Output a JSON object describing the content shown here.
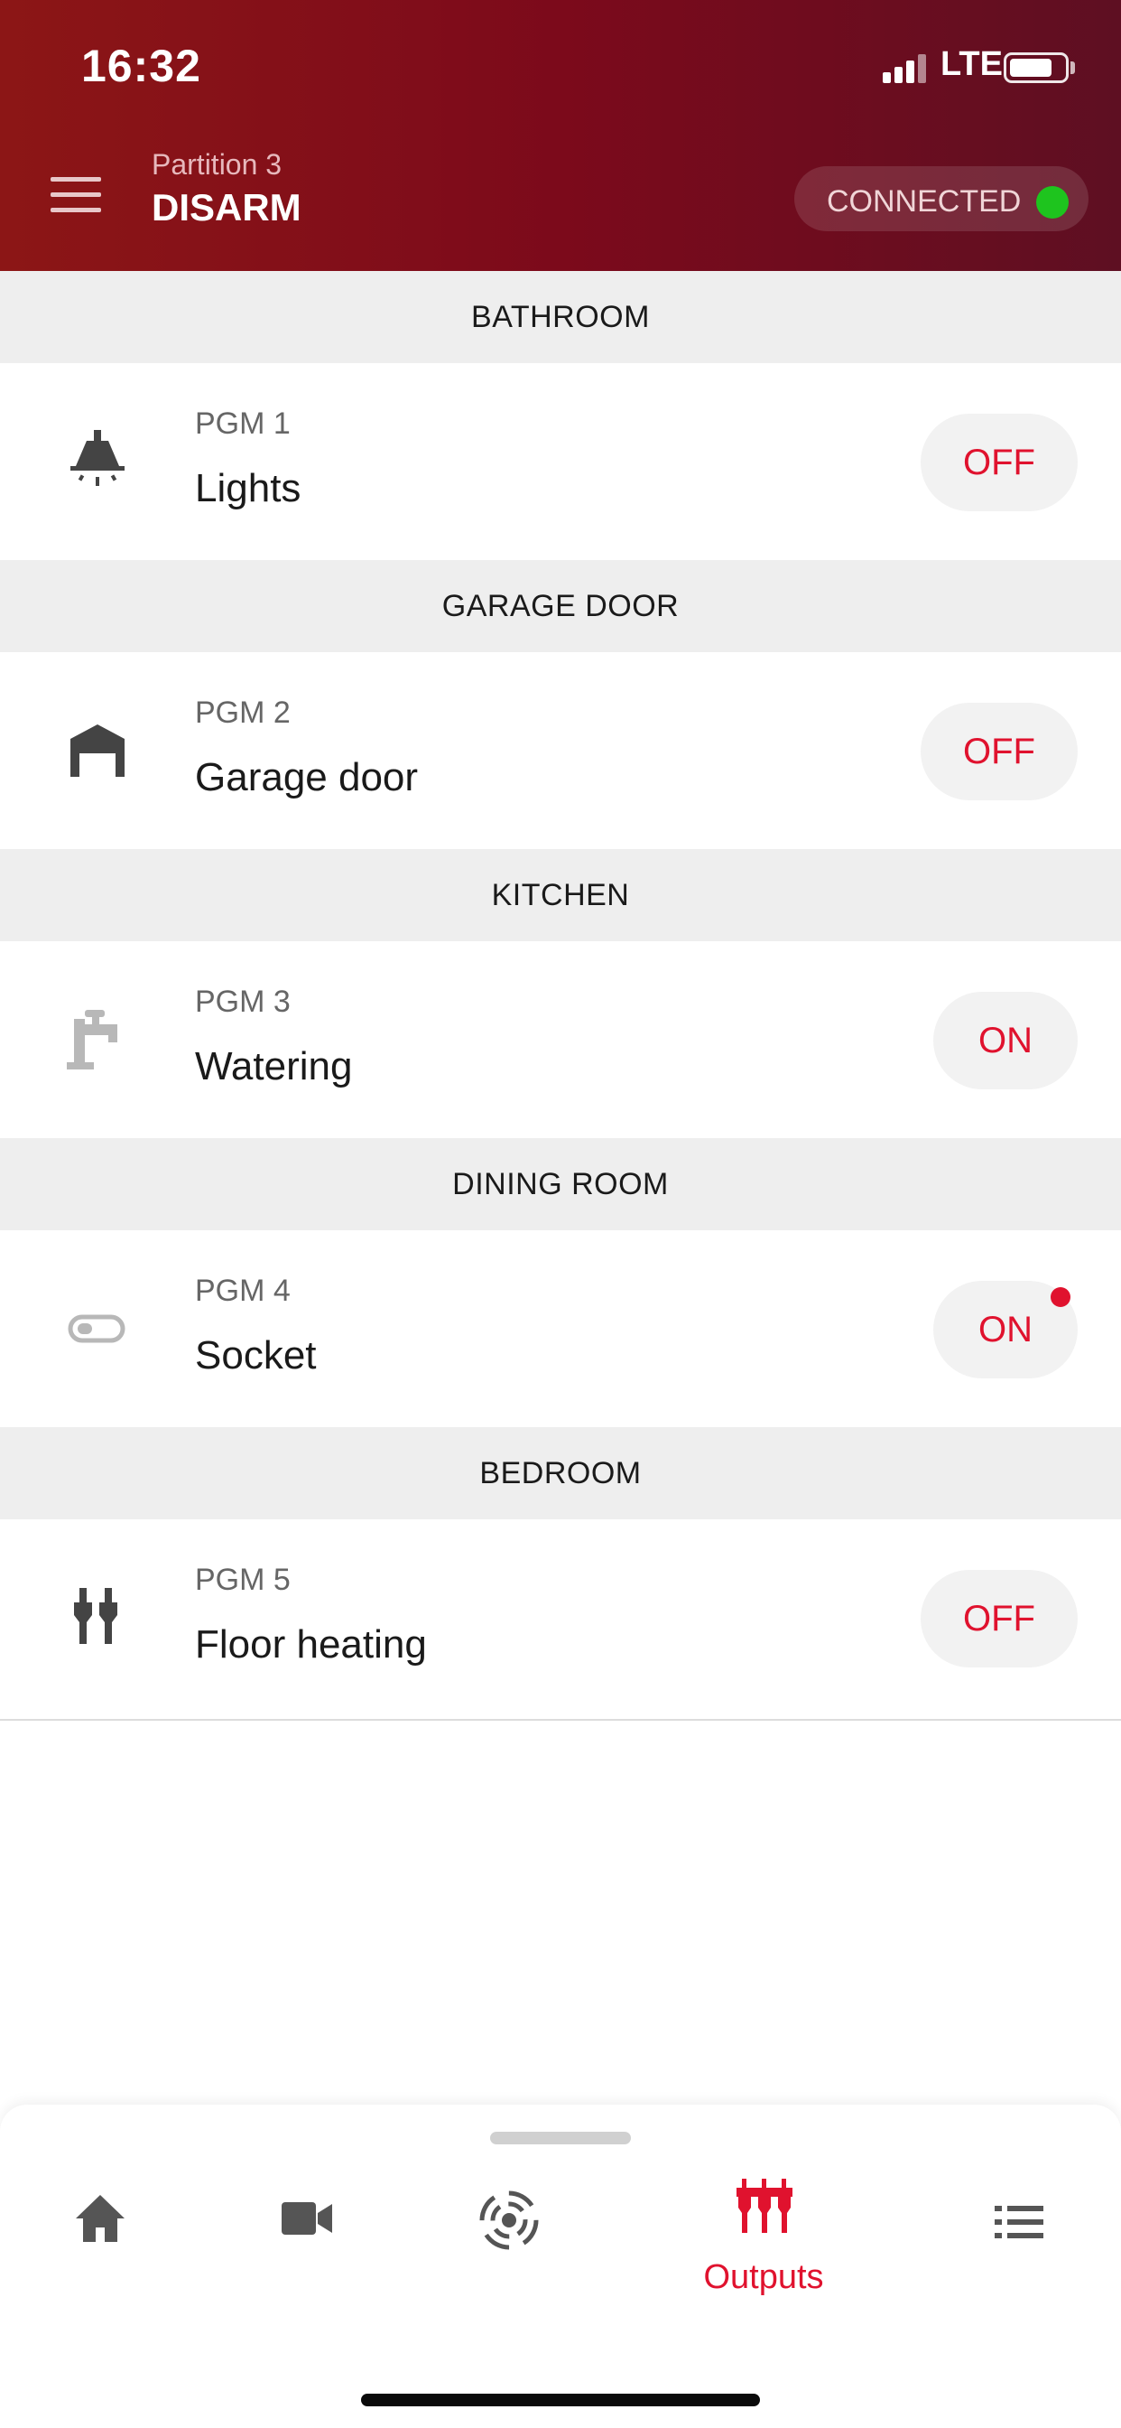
{
  "status_bar": {
    "time": "16:32",
    "network": "LTE"
  },
  "header": {
    "partition": "Partition 3",
    "mode": "DISARM",
    "connection": "CONNECTED",
    "connection_color": "#1ec41e"
  },
  "sections": [
    {
      "title": "BATHROOM",
      "pgm": "PGM 1",
      "name": "Lights",
      "state": "OFF",
      "icon": "ceiling-lamp-icon"
    },
    {
      "title": "GARAGE DOOR",
      "pgm": "PGM 2",
      "name": "Garage door",
      "state": "OFF",
      "icon": "garage-icon"
    },
    {
      "title": "KITCHEN",
      "pgm": "PGM 3",
      "name": "Watering",
      "state": "ON",
      "icon": "water-tap-icon"
    },
    {
      "title": "DINING ROOM",
      "pgm": "PGM 4",
      "name": "Socket",
      "state": "ON",
      "icon": "toggle-switch-icon"
    },
    {
      "title": "BEDROOM",
      "pgm": "PGM 5",
      "name": "Floor heating",
      "state": "OFF",
      "icon": "plug-icon"
    }
  ],
  "bottom_nav": {
    "items": [
      {
        "icon": "home-icon"
      },
      {
        "icon": "video-camera-icon"
      },
      {
        "icon": "sensor-icon"
      },
      {
        "icon": "outputs-icon",
        "label": "Outputs",
        "active": true
      },
      {
        "icon": "list-icon"
      }
    ]
  },
  "colors": {
    "accent": "#e0122e",
    "header_start": "#8c1616",
    "header_end": "#5e0f22"
  }
}
